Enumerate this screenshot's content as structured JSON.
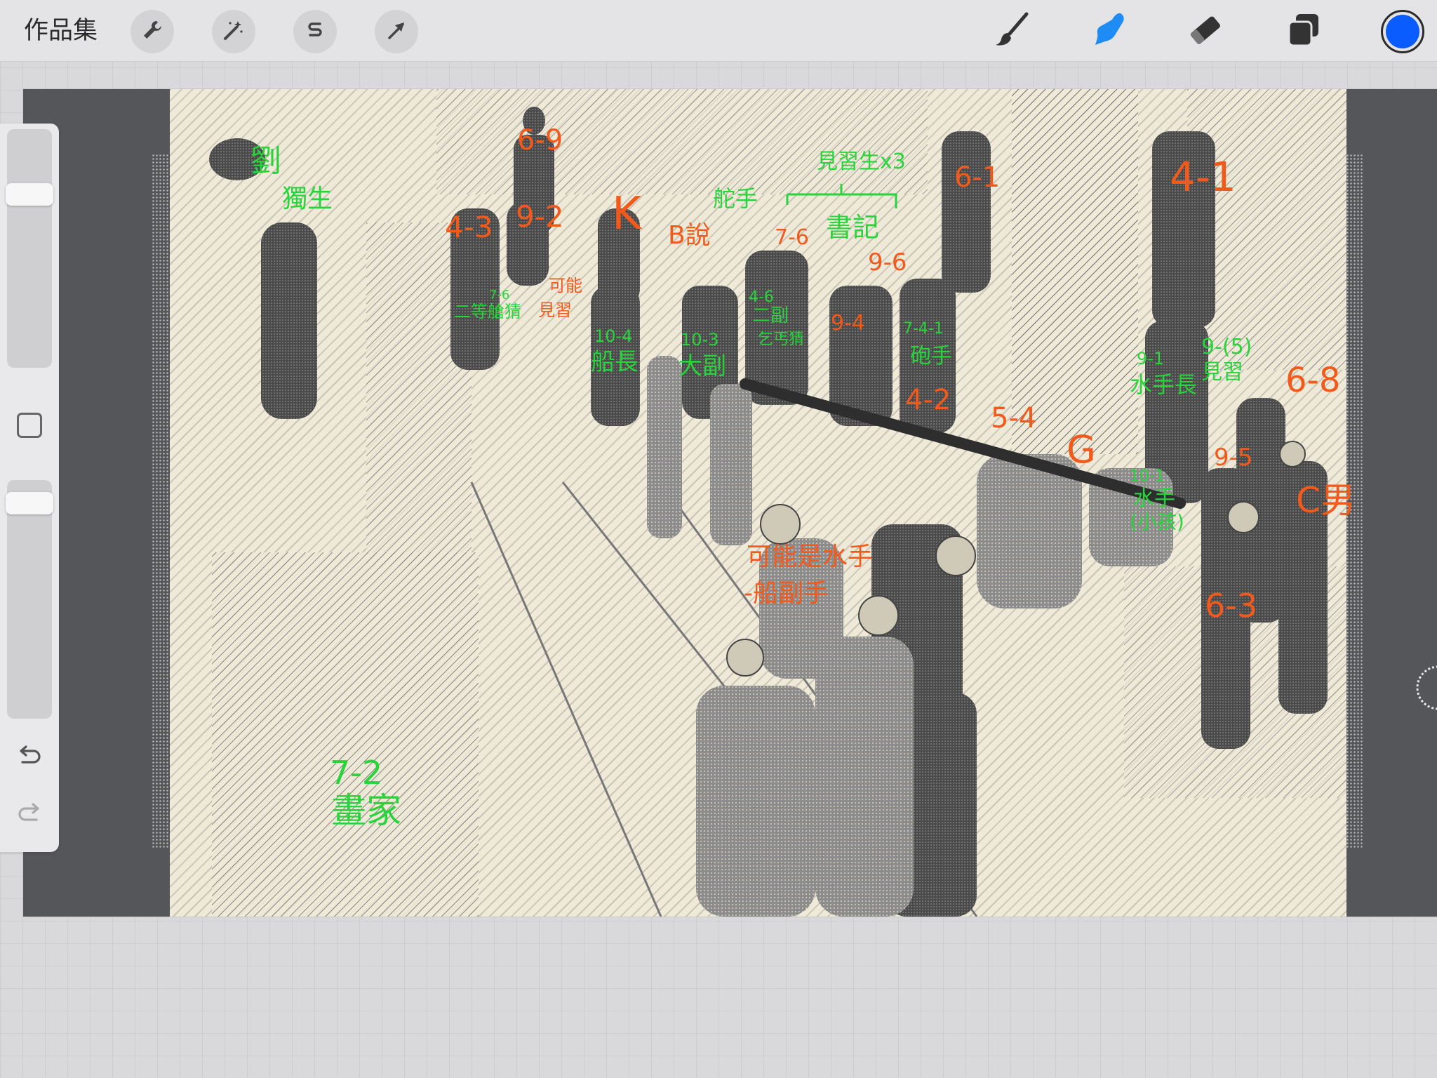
{
  "toolbar": {
    "gallery_label": "作品集",
    "left_tools": [
      {
        "name": "actions",
        "icon": "wrench-icon"
      },
      {
        "name": "adjustments",
        "icon": "magic-wand-icon"
      },
      {
        "name": "selection",
        "icon": "selection-s-icon"
      },
      {
        "name": "transform",
        "icon": "arrow-cursor-icon"
      }
    ],
    "right_tools": [
      {
        "name": "brush",
        "icon": "brush-icon",
        "active": false
      },
      {
        "name": "smudge",
        "icon": "smudge-finger-icon",
        "active": true
      },
      {
        "name": "eraser",
        "icon": "eraser-icon",
        "active": false
      },
      {
        "name": "layers",
        "icon": "layers-icon",
        "active": false
      }
    ],
    "current_color": "#0a5cff",
    "active_tool_color": "#1f8bf5"
  },
  "sidebar": {
    "brush_size_level": 0.22,
    "opacity_level": 0.05,
    "modify_icon": "square-icon",
    "undo_icon": "undo-arrow-icon",
    "redo_icon": "redo-arrow-icon"
  },
  "canvas": {
    "background": "#55565a",
    "artwork_bg": "#efe9d8",
    "annotations": {
      "a1": "劉",
      "a2": "獨生",
      "a3": "6-9",
      "a4": "4-3",
      "a5": "9-2",
      "a6": "K",
      "a7": "B說",
      "a8": "舵手",
      "a9": "見習生x3",
      "a10": "7-6",
      "a11": "書記",
      "a12": "9-6",
      "a13": "6-1",
      "a14": "4-1",
      "a15": "7-6",
      "a16": "二等艙猜",
      "a17": "可能",
      "a18": "見習",
      "a19": "10-4",
      "a20": "船長",
      "a21": "10-3",
      "a22": "大副",
      "a23": "4-6",
      "a24": "二副",
      "a25": "乞丐猜",
      "a26": "9-4",
      "a27": "7-4-1",
      "a28": "砲手",
      "a29": "4-2",
      "a30": "5-4",
      "a31": "9-1",
      "a32": "水手長",
      "a33": "9-(5)",
      "a34": "見習",
      "a35": "6-8",
      "a36": "G",
      "a37": "9-5",
      "a38": "10-1",
      "a39": "水手",
      "a40": "(小孩)",
      "a41": "C男",
      "a42": "可能是水手",
      "a43": "-船副手",
      "a44": "6-3",
      "a45": "7-2",
      "a46": "畫家"
    }
  }
}
